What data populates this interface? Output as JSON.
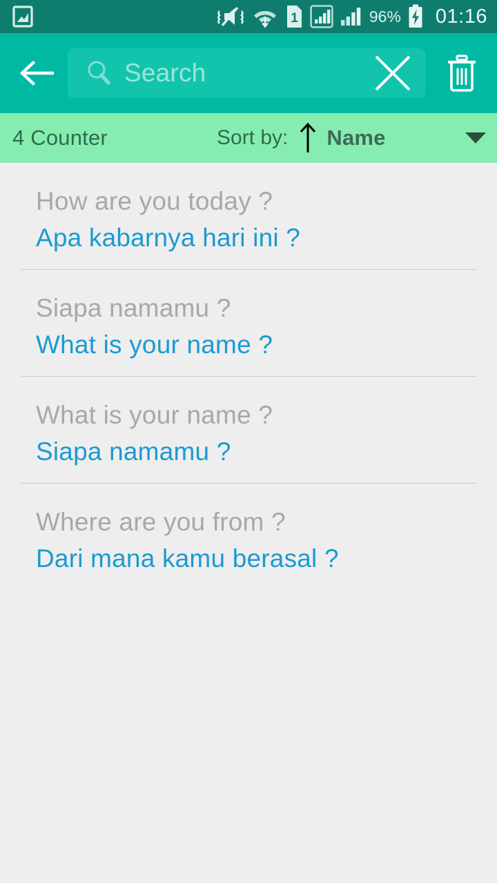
{
  "statusbar": {
    "notification_icon": "screenshot-image-icon",
    "icons": [
      "vibrate-mute-icon",
      "wifi-icon",
      "sim1-icon",
      "signal-bars-boxed-icon",
      "signal-bars-icon"
    ],
    "battery_percent": "96%",
    "battery_icon": "battery-charging-icon",
    "time": "01:16"
  },
  "toolbar": {
    "back_icon": "back-arrow-icon",
    "search_icon": "search-icon",
    "search_value": "",
    "search_placeholder": "Search",
    "clear_icon": "close-icon",
    "delete_icon": "trash-icon",
    "background": "#00b9a3",
    "field_background": "#13c4ad"
  },
  "sortbar": {
    "counter": "4 Counter",
    "sort_label": "Sort by:",
    "sort_direction_icon": "arrow-up-icon",
    "sort_value": "Name",
    "dropdown_icon": "chevron-down-icon",
    "background": "#85edb0"
  },
  "list": {
    "source_color": "#a8a8a8",
    "target_color": "#1b9ad1",
    "items": [
      {
        "source": "How are you today ?",
        "target": "Apa kabarnya hari ini ?"
      },
      {
        "source": "Siapa namamu ?",
        "target": "What is your name ?"
      },
      {
        "source": "What is your name ?",
        "target": "Siapa namamu ?"
      },
      {
        "source": "Where are you from ?",
        "target": "Dari mana kamu berasal ?"
      }
    ]
  }
}
